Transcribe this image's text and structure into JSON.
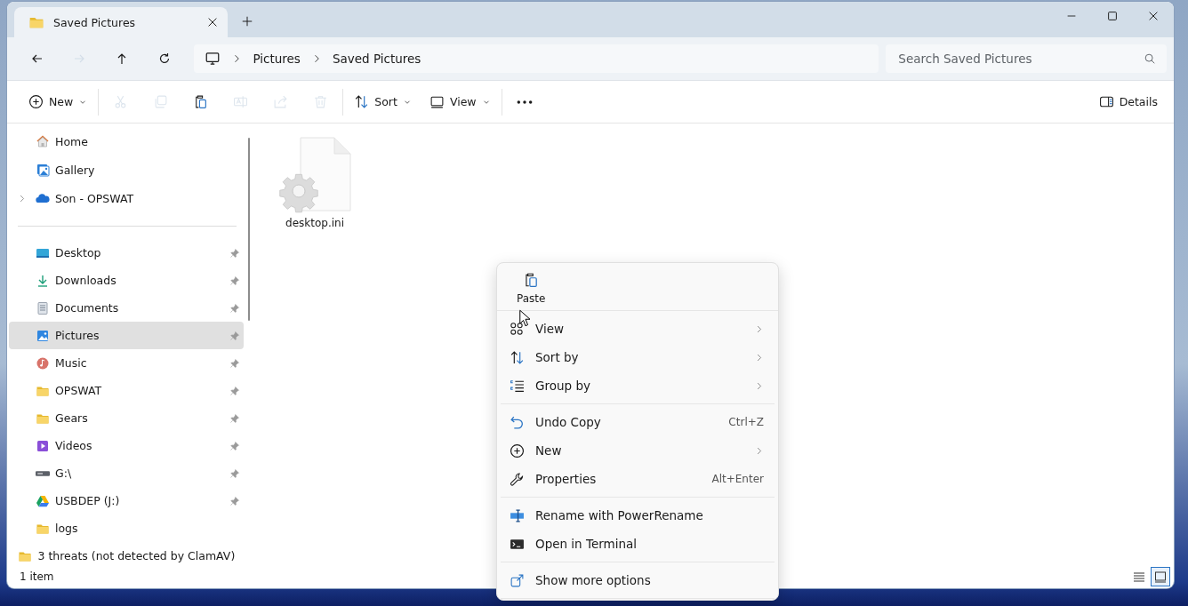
{
  "window": {
    "tab": {
      "title": "Saved Pictures"
    }
  },
  "nav": {
    "buttons": [
      {
        "kind": "back",
        "disabled": false
      },
      {
        "kind": "forward",
        "disabled": true
      },
      {
        "kind": "up",
        "disabled": false
      },
      {
        "kind": "refresh",
        "disabled": false
      }
    ],
    "breadcrumb": [
      "Pictures",
      "Saved Pictures"
    ],
    "search": {
      "placeholder": "Search Saved Pictures"
    }
  },
  "commands": [
    {
      "kind": "new",
      "label": "New",
      "dropdown": true,
      "disabled": false
    },
    {
      "kind": "cut",
      "disabled": true
    },
    {
      "kind": "copy",
      "disabled": true
    },
    {
      "kind": "paste",
      "disabled": false
    },
    {
      "kind": "rename",
      "disabled": true
    },
    {
      "kind": "share",
      "disabled": true
    },
    {
      "kind": "delete",
      "disabled": true
    },
    {
      "kind": "sort",
      "label": "Sort",
      "dropdown": true,
      "disabled": false
    },
    {
      "kind": "view",
      "label": "View",
      "dropdown": true,
      "disabled": false
    },
    {
      "kind": "more",
      "disabled": false
    }
  ],
  "details_button": {
    "label": "Details"
  },
  "sidebar": {
    "top": [
      {
        "label": "Home",
        "kind": "home",
        "expandable": false
      },
      {
        "label": "Gallery",
        "kind": "gallery",
        "expandable": false
      },
      {
        "label": "Son - OPSWAT",
        "kind": "cloud",
        "expandable": true
      }
    ],
    "quick_access": [
      {
        "label": "Desktop",
        "kind": "desktop",
        "pinned": true,
        "selected": false
      },
      {
        "label": "Downloads",
        "kind": "downloads",
        "pinned": true,
        "selected": false
      },
      {
        "label": "Documents",
        "kind": "documents",
        "pinned": true,
        "selected": false
      },
      {
        "label": "Pictures",
        "kind": "pictures",
        "pinned": true,
        "selected": true
      },
      {
        "label": "Music",
        "kind": "music",
        "pinned": true,
        "selected": false
      },
      {
        "label": "OPSWAT",
        "kind": "folder",
        "pinned": true,
        "selected": false
      },
      {
        "label": "Gears",
        "kind": "folder",
        "pinned": true,
        "selected": false
      },
      {
        "label": "Videos",
        "kind": "videos",
        "pinned": true,
        "selected": false
      },
      {
        "label": "G:\\",
        "kind": "drive",
        "pinned": true,
        "selected": false
      },
      {
        "label": "USBDEP (J:)",
        "kind": "gdrive",
        "pinned": true,
        "selected": false
      },
      {
        "label": "logs",
        "kind": "folder",
        "pinned": false,
        "selected": false
      },
      {
        "label": "3 threats (not detected by ClamAV)",
        "kind": "folder",
        "pinned": false,
        "selected": false
      }
    ]
  },
  "files": [
    {
      "name": "desktop.ini"
    }
  ],
  "status_bar": {
    "count": "1 item",
    "views": [
      {
        "kind": "details",
        "selected": false
      },
      {
        "kind": "tiles",
        "selected": true
      }
    ]
  },
  "context_menu": {
    "top_actions": [
      {
        "kind": "paste",
        "label": "Paste"
      }
    ],
    "groups": [
      [
        {
          "kind": "view",
          "label": "View",
          "submenu": true
        },
        {
          "kind": "sort",
          "label": "Sort by",
          "submenu": true
        },
        {
          "kind": "group",
          "label": "Group by",
          "submenu": true
        }
      ],
      [
        {
          "kind": "undo",
          "label": "Undo Copy",
          "shortcut": "Ctrl+Z",
          "submenu": false
        },
        {
          "kind": "new",
          "label": "New",
          "submenu": true
        },
        {
          "kind": "properties",
          "label": "Properties",
          "shortcut": "Alt+Enter",
          "submenu": false
        }
      ],
      [
        {
          "kind": "powerrename",
          "label": "Rename with PowerRename",
          "submenu": false
        },
        {
          "kind": "terminal",
          "label": "Open in Terminal",
          "submenu": false
        }
      ],
      [
        {
          "kind": "more",
          "label": "Show more options",
          "submenu": false
        }
      ]
    ]
  }
}
